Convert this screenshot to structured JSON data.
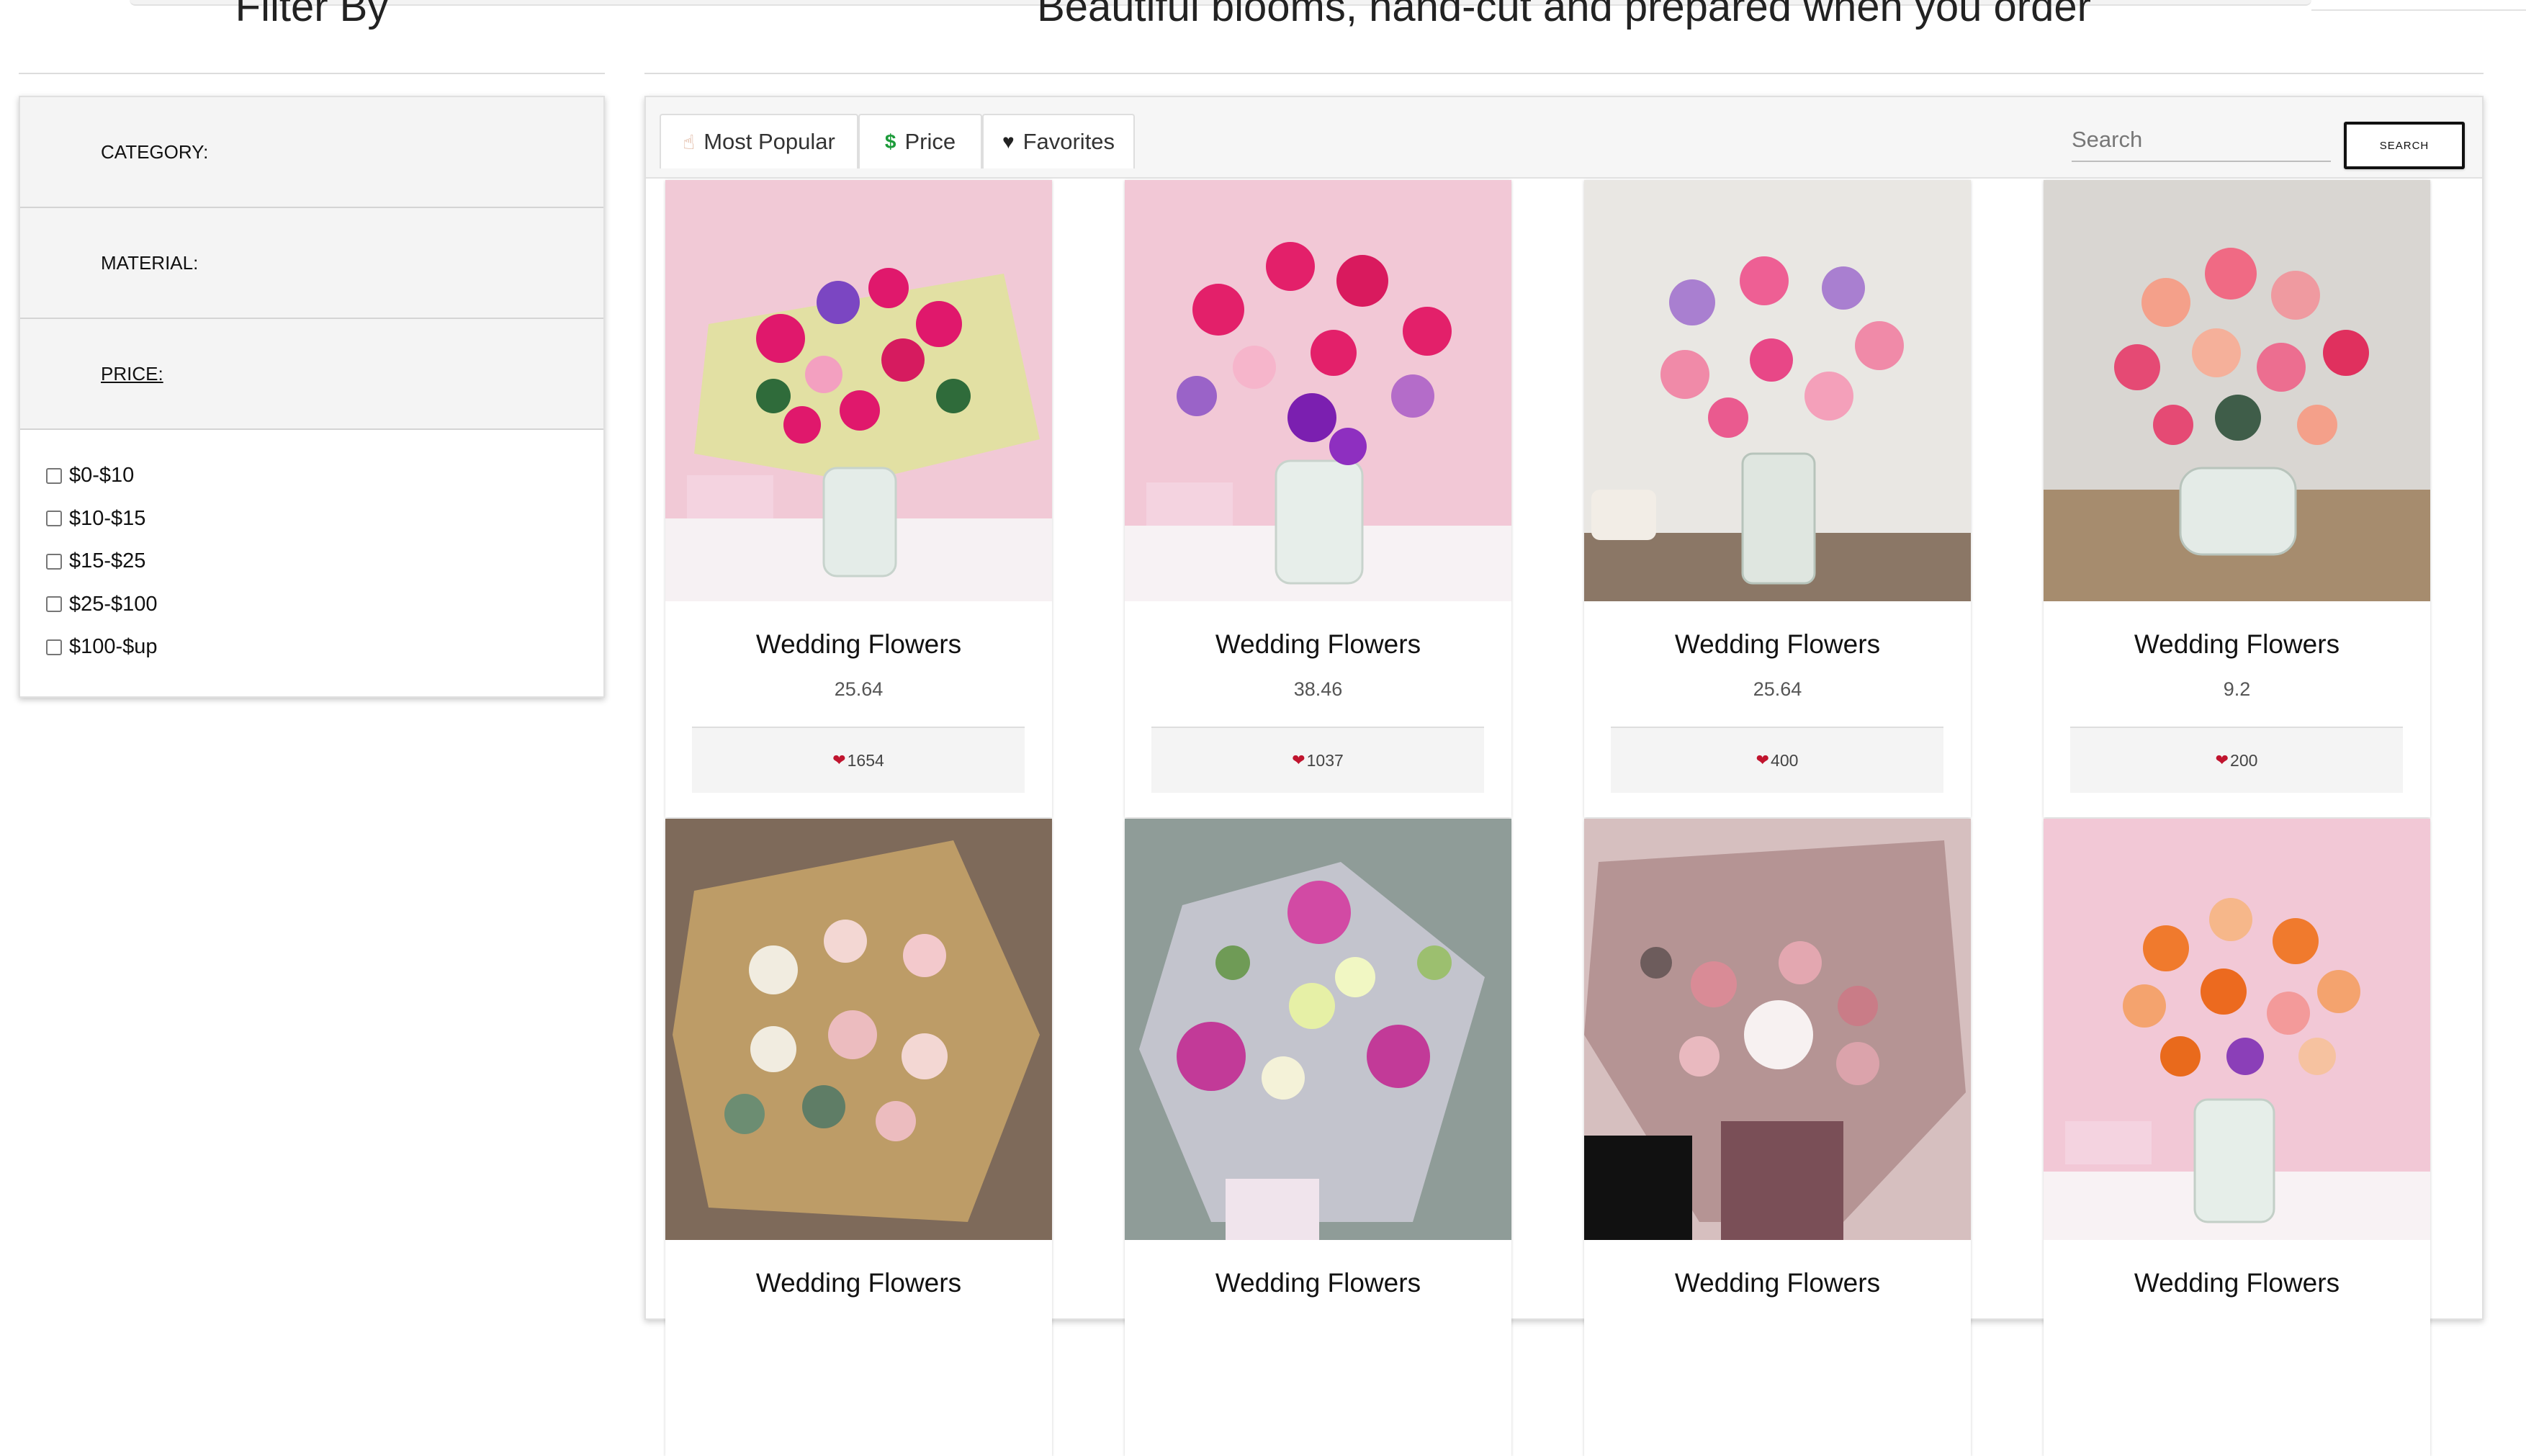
{
  "sidebar": {
    "title": "Filter By",
    "sections": [
      "CATEGORY:",
      "MATERIAL:",
      "PRICE:"
    ],
    "price_options": [
      "$0-$10",
      "$10-$15",
      "$15-$25",
      "$25-$100",
      "$100-$up"
    ]
  },
  "main": {
    "title": "Beautiful blooms, hand-cut and prepared when you order",
    "tabs": [
      {
        "label": "Most Popular",
        "icon": "hand-pointer-icon"
      },
      {
        "label": "Price",
        "icon": "dollar-icon"
      },
      {
        "label": "Favorites",
        "icon": "heart-icon"
      }
    ],
    "search": {
      "placeholder": "Search",
      "button_label": "SEARCH"
    },
    "products": [
      {
        "title": "Wedding Flowers",
        "price": "25.64",
        "likes": "1654"
      },
      {
        "title": "Wedding Flowers",
        "price": "38.46",
        "likes": "1037"
      },
      {
        "title": "Wedding Flowers",
        "price": "25.64",
        "likes": "400"
      },
      {
        "title": "Wedding Flowers",
        "price": "9.2",
        "likes": "200"
      },
      {
        "title": "Wedding Flowers"
      },
      {
        "title": "Wedding Flowers"
      },
      {
        "title": "Wedding Flowers"
      },
      {
        "title": "Wedding Flowers"
      }
    ]
  },
  "colors": {
    "accent_heart": "#c0142e",
    "price_icon": "#1c9b3a",
    "panel_bg": "#f4f4f4"
  }
}
